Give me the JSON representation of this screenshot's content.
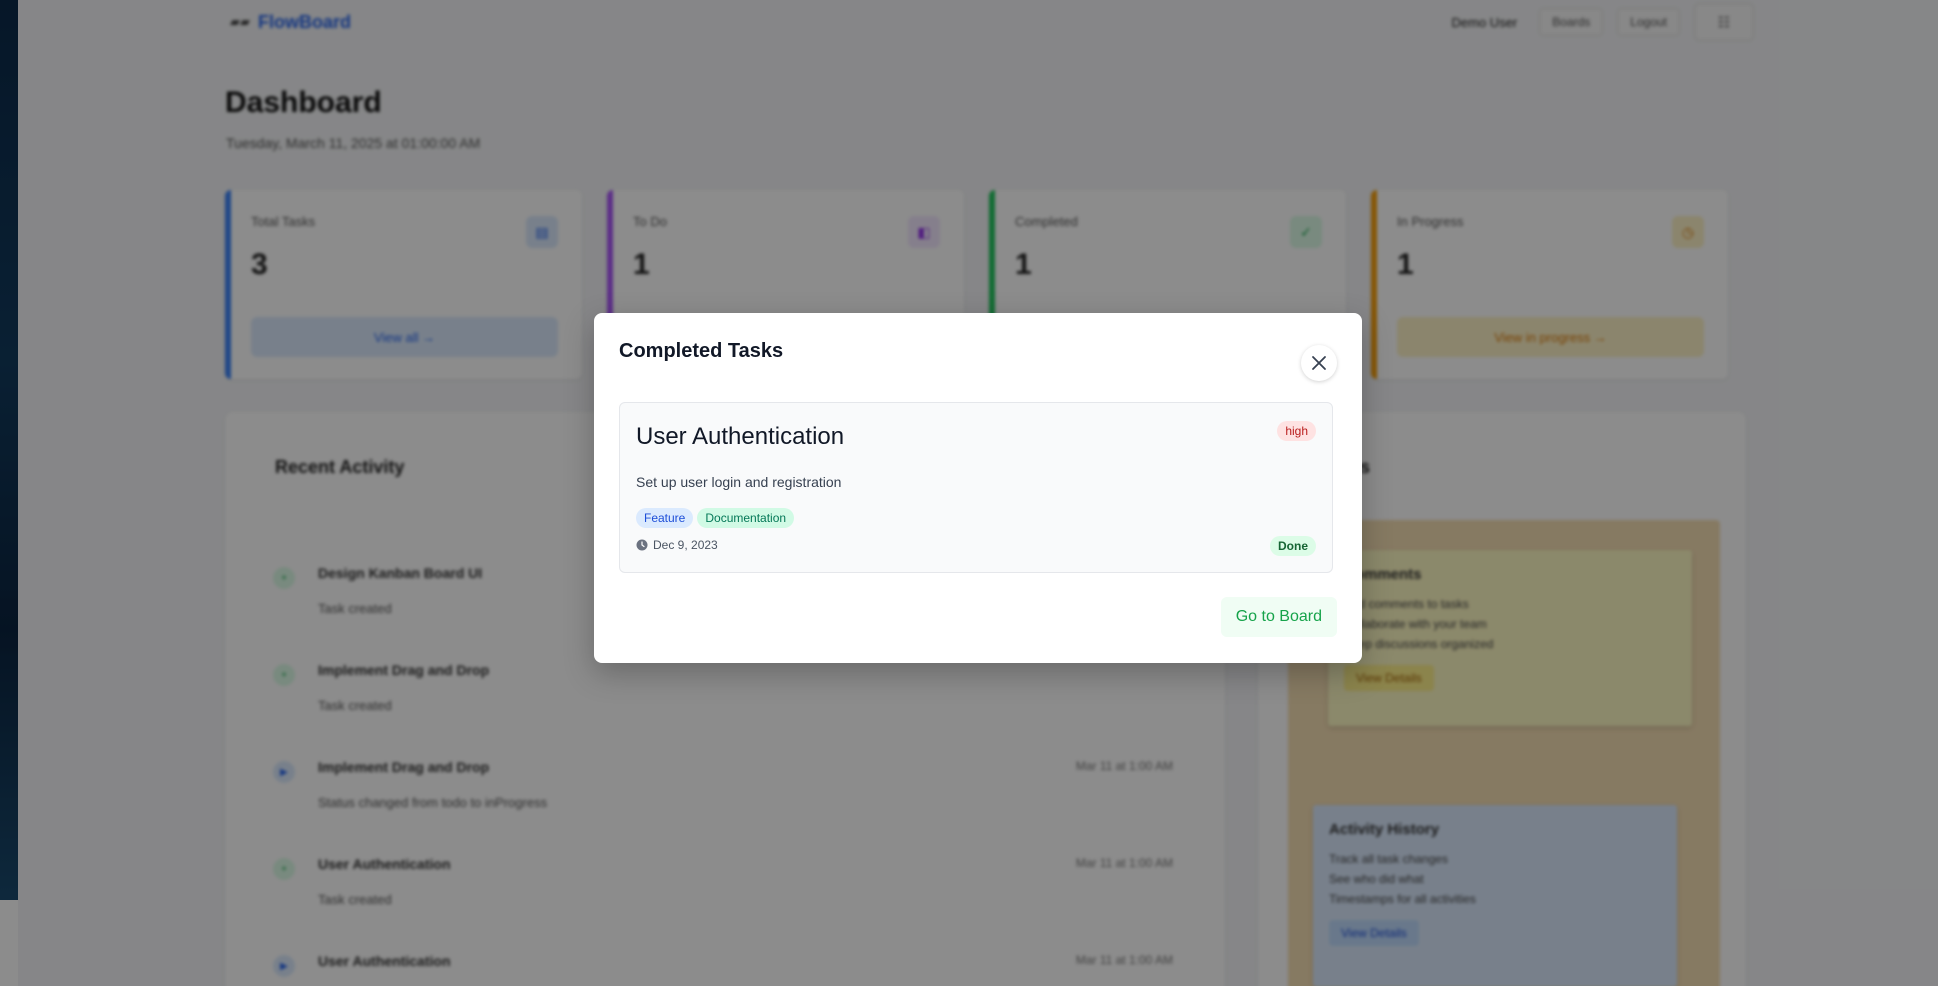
{
  "header": {
    "logo_text": "FlowBoard",
    "user_name": "Demo User",
    "boards_label": "Boards",
    "logout_label": "Logout",
    "theme_icon": "grid-icon"
  },
  "page": {
    "title": "Dashboard",
    "datetime": "Tuesday, March 11, 2025 at 01:00:00 AM"
  },
  "stats": [
    {
      "label": "Total Tasks",
      "value": "3",
      "link": "View all →",
      "color": "#3b82f6"
    },
    {
      "label": "To Do",
      "value": "1",
      "link": "",
      "color": "#a855f7"
    },
    {
      "label": "Completed",
      "value": "1",
      "link": "",
      "color": "#22c55e"
    },
    {
      "label": "In Progress",
      "value": "1",
      "link": "View in progress →",
      "color": "#f59e0b"
    }
  ],
  "activity": {
    "title": "Recent Activity",
    "items": [
      {
        "title": "Design Kanban Board UI",
        "desc": "Task created",
        "time": ""
      },
      {
        "title": "Implement Drag and Drop",
        "desc": "Task created",
        "time": ""
      },
      {
        "title": "Implement Drag and Drop",
        "desc": "Status changed from todo to inProgress",
        "time": "Mar 11 at 1:00 AM"
      },
      {
        "title": "User Authentication",
        "desc": "Task created",
        "time": "Mar 11 at 1:00 AM"
      },
      {
        "title": "User Authentication",
        "desc": "",
        "time": "Mar 11 at 1:00 AM"
      }
    ]
  },
  "notes_panel": {
    "title_fragment": "es",
    "notes": [
      {
        "title": "Comments",
        "items": [
          "Add comments to tasks",
          "Collaborate with your team",
          "Keep discussions organized"
        ],
        "button": "View Details"
      },
      {
        "title": "Activity History",
        "items": [
          "Track all task changes",
          "See who did what",
          "Timestamps for all activities"
        ],
        "button": "View Details"
      }
    ]
  },
  "modal": {
    "title": "Completed Tasks",
    "task": {
      "title": "User Authentication",
      "priority": "high",
      "description": "Set up user login and registration",
      "tags": [
        "Feature",
        "Documentation"
      ],
      "date": "Dec 9, 2023",
      "status": "Done"
    },
    "go_to_board_label": "Go to Board"
  }
}
